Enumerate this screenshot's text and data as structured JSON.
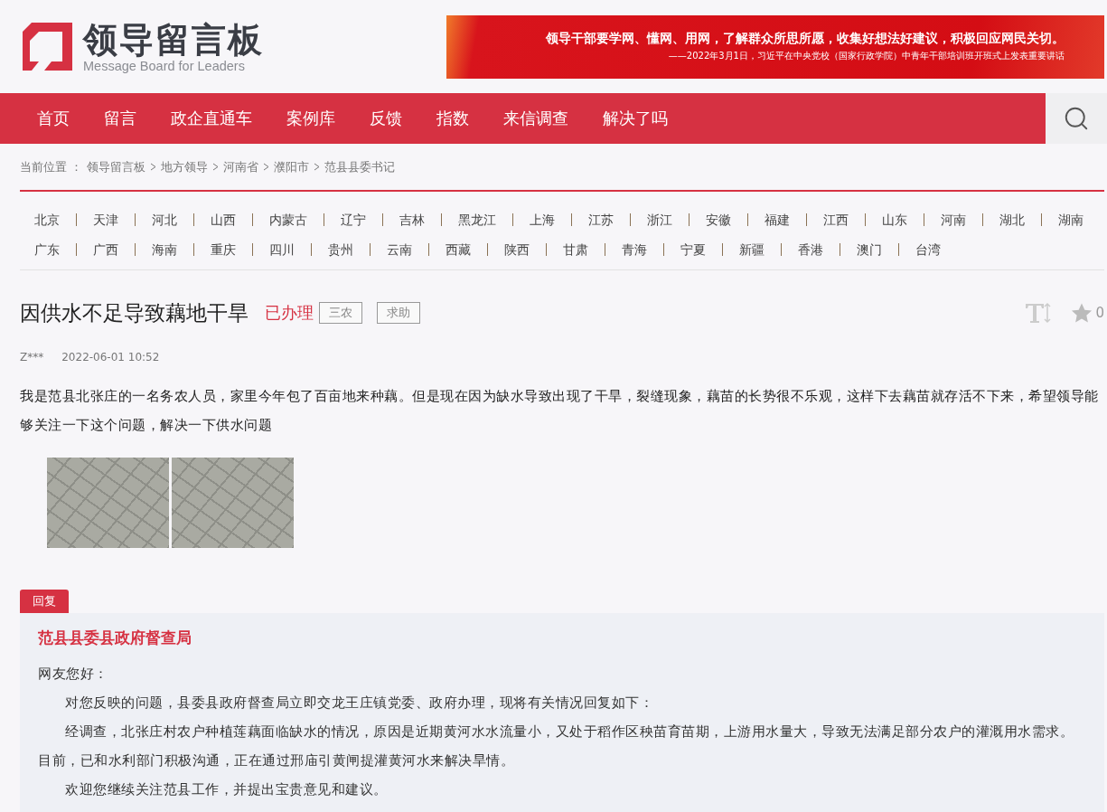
{
  "logo": {
    "title": "领导留言板",
    "subtitle": "Message Board for Leaders"
  },
  "banner": {
    "quote": "领导干部要学网、懂网、用网，了解群众所思所愿，收集好想法好建议，积极回应网民关切。",
    "source": "——2022年3月1日，习近平在中央党校（国家行政学院）中青年干部培训班开班式上发表重要讲话"
  },
  "nav": [
    "首页",
    "留言",
    "政企直通车",
    "案例库",
    "反馈",
    "指数",
    "来信调查",
    "解决了吗"
  ],
  "breadcrumb": {
    "label": "当前位置 ：",
    "items": [
      "领导留言板",
      "地方领导",
      "河南省",
      "濮阳市",
      "范县县委书记"
    ]
  },
  "region_rows": [
    {
      "items": [
        "北京",
        "天津",
        "河北",
        "山西",
        "内蒙古",
        "辽宁",
        "吉林",
        "黑龙江",
        "上海",
        "江苏",
        "浙江",
        "安徽",
        "福建",
        "江西",
        "山东",
        "河南",
        "湖北",
        "湖南"
      ]
    },
    {
      "items": [
        "广东",
        "广西",
        "海南",
        "重庆",
        "四川",
        "贵州",
        "云南",
        "西藏",
        "陕西",
        "甘肃",
        "青海",
        "宁夏",
        "新疆",
        "香港",
        "澳门",
        "台湾"
      ]
    }
  ],
  "post": {
    "title": "因供水不足导致藕地干旱",
    "status": "已办理",
    "tags": [
      "三农",
      "求助"
    ],
    "favorite_count": "0",
    "author": "Z***",
    "time": "2022-06-01 10:52",
    "body": "我是范县北张庄的一名务农人员，家里今年包了百亩地来种藕。但是现在因为缺水导致出现了干旱，裂缝现象，藕苗的长势很不乐观，这样下去藕苗就存活不下来，希望领导能够关注一下这个问题，解决一下供水问题",
    "photos": [
      {
        "kind": "photo"
      },
      {
        "kind": "photo"
      }
    ]
  },
  "reply": {
    "tab": "回复",
    "department": "范县县委县政府督查局",
    "greeting": "网友您好：",
    "paragraphs": [
      "对您反映的问题，县委县政府督查局立即交龙王庄镇党委、政府办理，现将有关情况回复如下：",
      "经调查，北张庄村农户种植莲藕面临缺水的情况，原因是近期黄河水水流量小，又处于稻作区秧苗育苗期，上游用水量大，导致无法满足部分农户的灌溉用水需求。目前，已和水利部门积极沟通，正在通过邢庙引黄闸提灌黄河水来解决旱情。",
      "欢迎您继续关注范县工作，并提出宝贵意见和建议。"
    ]
  }
}
